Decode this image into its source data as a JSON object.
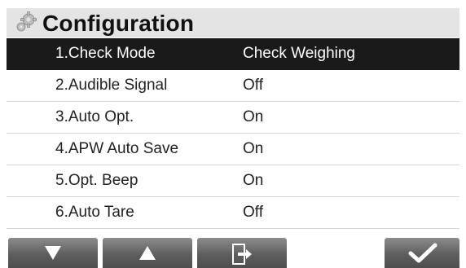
{
  "header": {
    "title": "Configuration",
    "icon": "gear-icon"
  },
  "menu": {
    "items": [
      {
        "label": "1.Check Mode",
        "value": "Check Weighing",
        "selected": true
      },
      {
        "label": "2.Audible Signal",
        "value": "Off"
      },
      {
        "label": "3.Auto Opt.",
        "value": "On"
      },
      {
        "label": "4.APW Auto Save",
        "value": "On"
      },
      {
        "label": "5.Opt. Beep",
        "value": "On"
      },
      {
        "label": "6.Auto Tare",
        "value": "Off"
      }
    ]
  },
  "softkeys": [
    {
      "icon": "arrow-down-icon"
    },
    {
      "icon": "arrow-up-icon"
    },
    {
      "icon": "exit-icon"
    },
    {
      "icon": "checkmark-icon"
    }
  ],
  "colors": {
    "selected_row": "#1a1a1a",
    "header_bg": "#e4e4e4",
    "softkey": "#5e5e5e"
  }
}
